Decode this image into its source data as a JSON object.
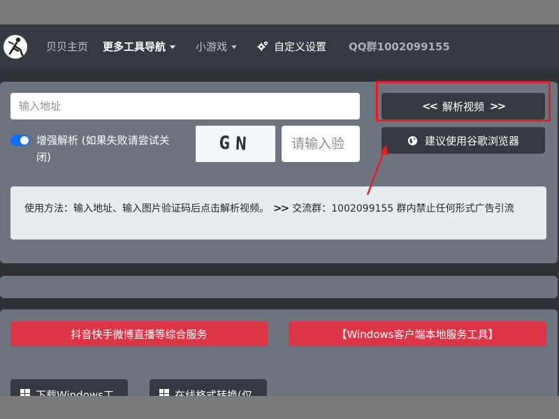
{
  "nav": {
    "home": "贝贝主页",
    "more_tools": "更多工具导航",
    "mini_games": "小游戏",
    "custom_settings": "自定义设置",
    "qq_group": "QQ群1002099155"
  },
  "form": {
    "url_placeholder": "输入地址",
    "enhanced_label": "增强解析 (如果失败请尝试关闭)",
    "enhanced_on": true,
    "captcha_text": "GN",
    "captcha_placeholder": "请输入验",
    "parse_button": "解析视频",
    "browser_button": "建议使用谷歌浏览器"
  },
  "info": {
    "text_before": "使用方法：输入地址、输入图片验证码后点击解析视频。",
    "text_after": "交流群：1002099155 群内禁止任何形式广告引流"
  },
  "services": {
    "douyin": "抖音快手微博直播等综合服务",
    "windows_tool": "【Windows客户端本地服务工具】",
    "download_windows": "下载Windows工",
    "online_convert": "在线格式转换(仅"
  },
  "colors": {
    "nav_bg": "#343a40",
    "panel_bg": "#6c757d",
    "accent_red": "#dc3545",
    "toggle_blue": "#0d6efd",
    "highlight_red": "#e11d2a"
  },
  "icons": [
    "logo-icon",
    "caret-down-icon",
    "gear-icon",
    "double-chevron-left-icon",
    "double-chevron-right-icon",
    "globe-icon",
    "windows-icon"
  ]
}
